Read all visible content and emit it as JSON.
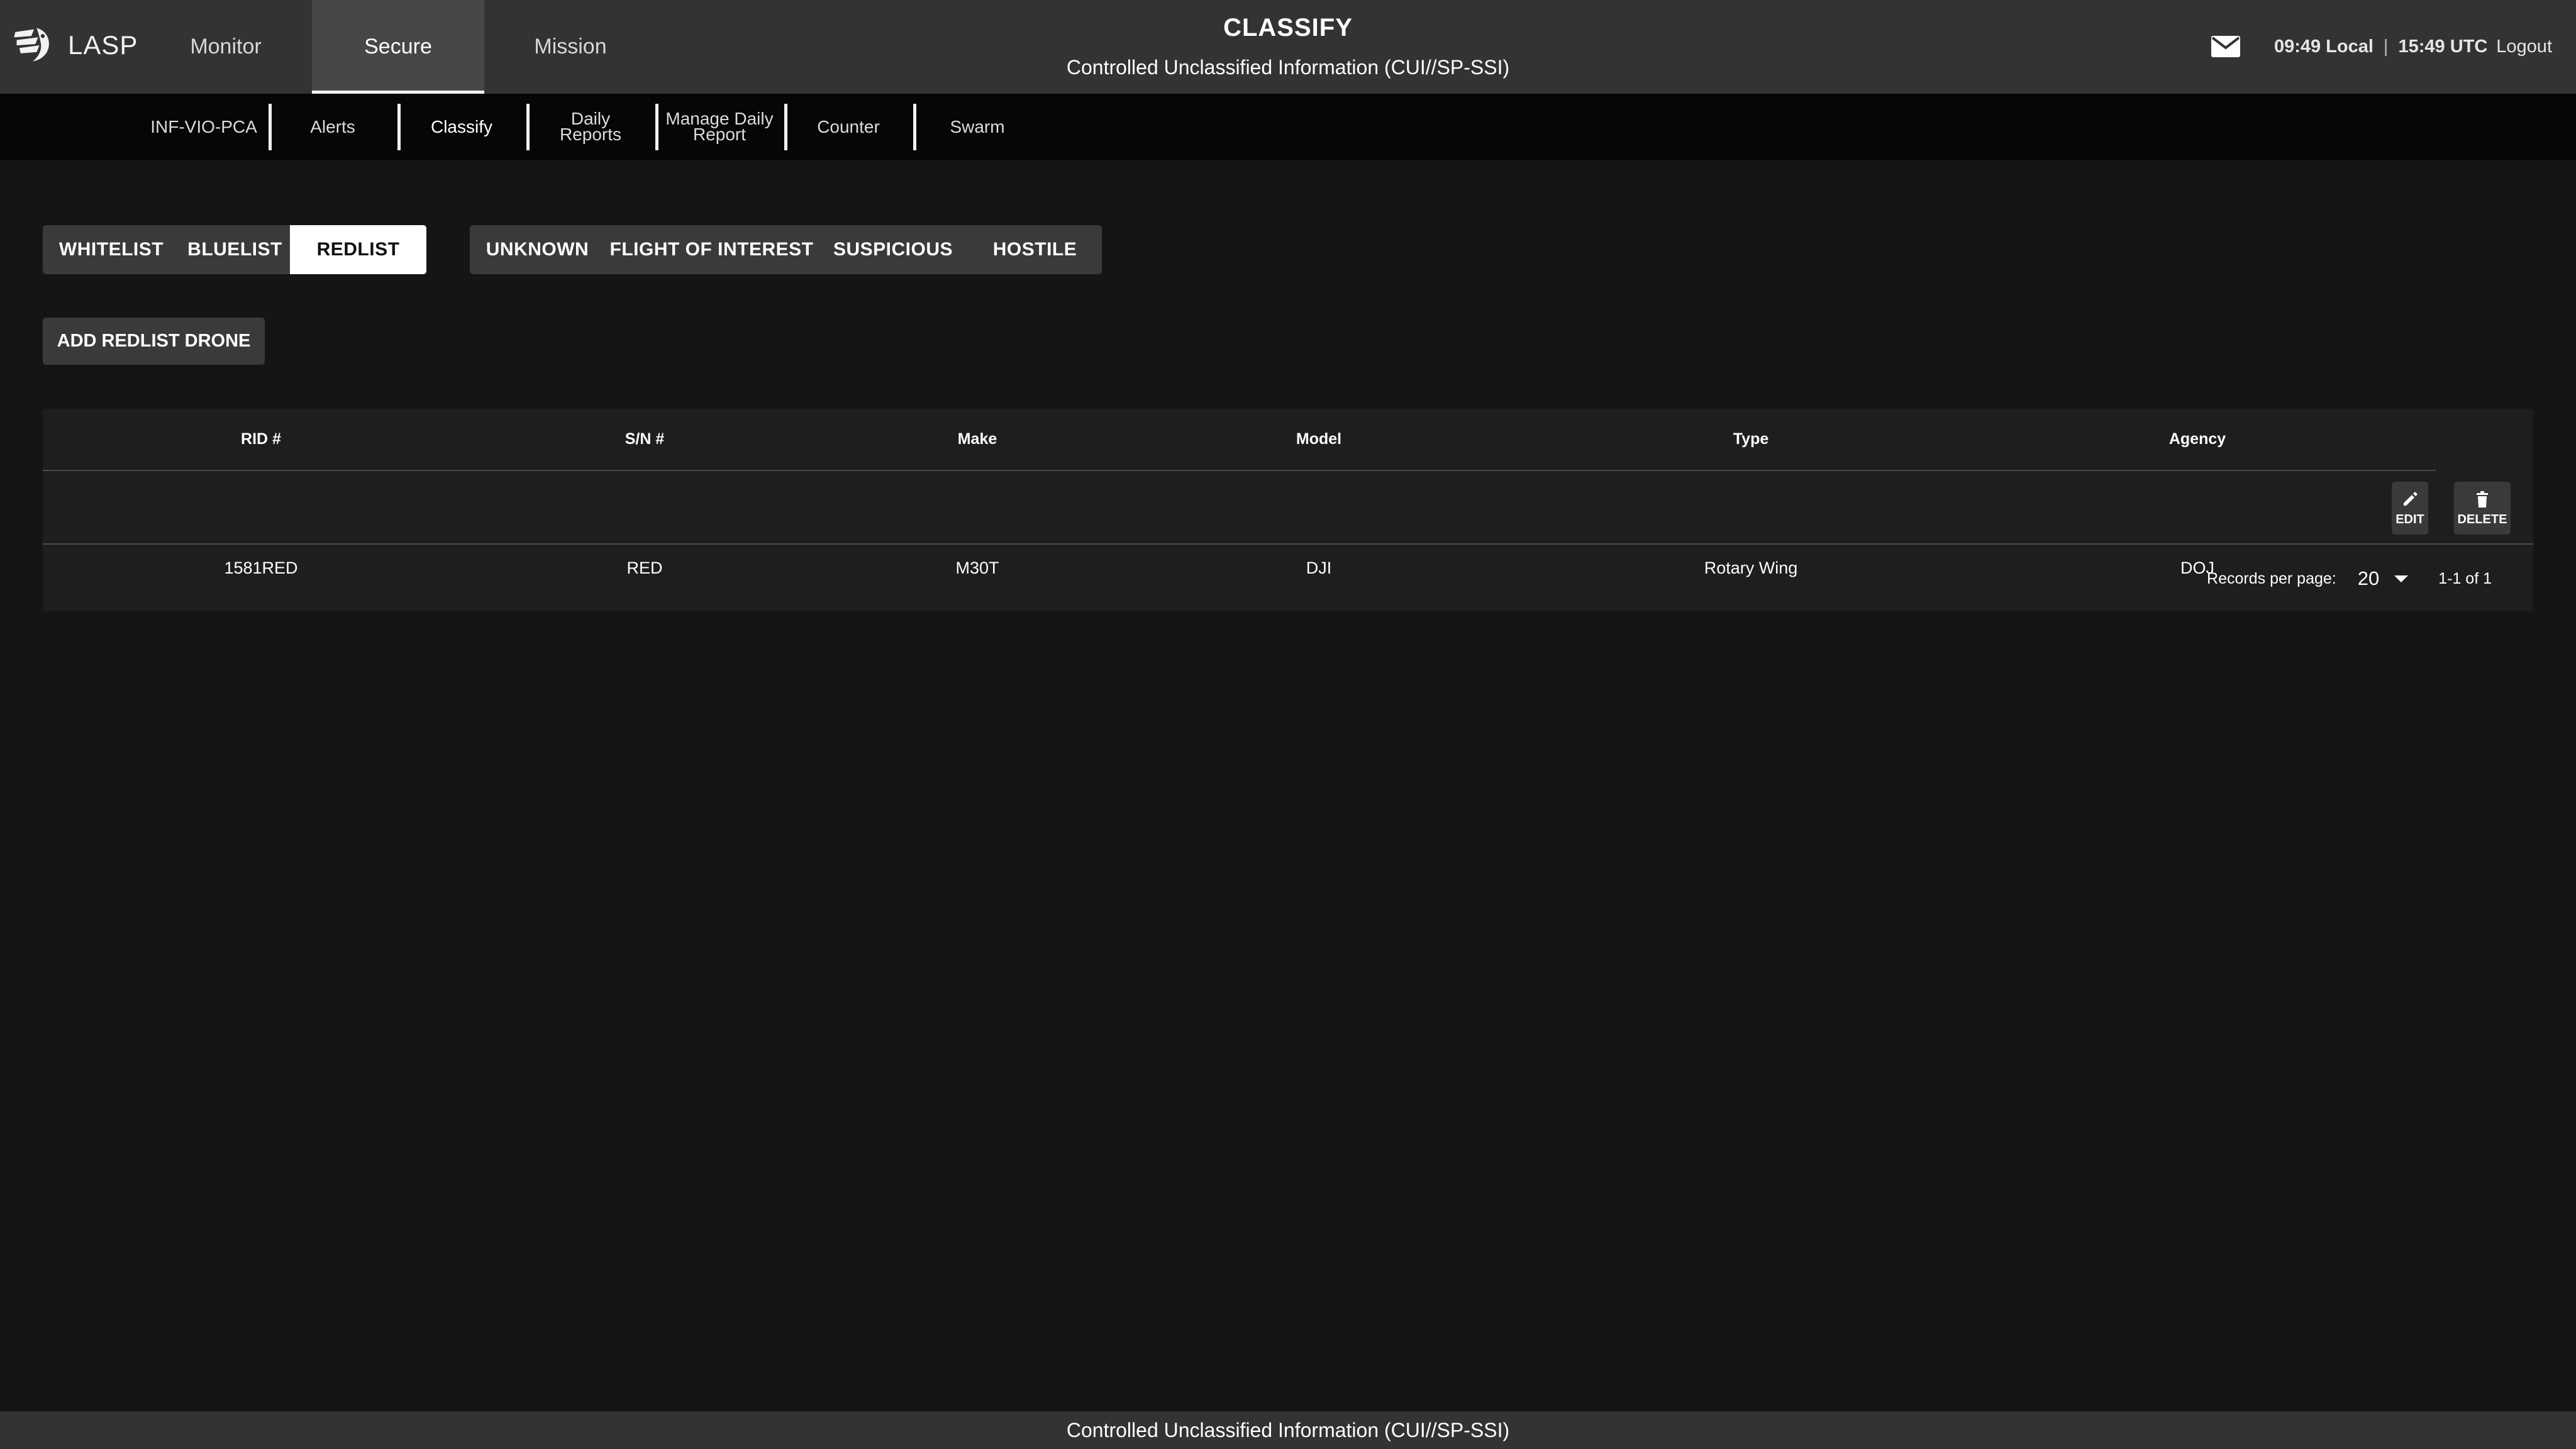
{
  "brand": {
    "name": "LASP"
  },
  "main_tabs": [
    {
      "label": "Monitor"
    },
    {
      "label": "Secure"
    },
    {
      "label": "Mission"
    }
  ],
  "header": {
    "title": "CLASSIFY",
    "subtitle": "Controlled Unclassified Information (CUI//SP-SSI)",
    "local_time": "09:49 Local",
    "separator": "|",
    "utc_time": "15:49 UTC",
    "logout_label": "Logout",
    "mail_icon": "mail-icon"
  },
  "sub_tabs": [
    {
      "line1": "INF-VIO-PCA",
      "line2": ""
    },
    {
      "line1": "Alerts",
      "line2": ""
    },
    {
      "line1": "Classify",
      "line2": ""
    },
    {
      "line1": "Daily",
      "line2": "Reports"
    },
    {
      "line1": "Manage Daily",
      "line2": "Report"
    },
    {
      "line1": "Counter",
      "line2": ""
    },
    {
      "line1": "Swarm",
      "line2": ""
    }
  ],
  "list_toggle": [
    "WHITELIST",
    "BLUELIST",
    "REDLIST"
  ],
  "list_toggle_selected": "REDLIST",
  "class_toggle": [
    "UNKNOWN",
    "FLIGHT OF INTEREST",
    "SUSPICIOUS",
    "HOSTILE"
  ],
  "add_button": "ADD REDLIST DRONE",
  "table": {
    "columns": [
      "RID #",
      "S/N #",
      "Make",
      "Model",
      "Type",
      "Agency"
    ],
    "rows": [
      [
        "1581RED",
        "RED",
        "M30T",
        "DJI",
        "Rotary Wing",
        "DOJ"
      ]
    ],
    "edit_label": "EDIT",
    "delete_label": "DELETE"
  },
  "pagination": {
    "records_label": "Records per page:",
    "per_page": "20",
    "range": "1-1 of 1"
  },
  "footer": {
    "text": "Controlled Unclassified Information (CUI//SP-SSI)"
  },
  "colors": {
    "background": "#151515",
    "topbar": "#333333",
    "subnav": "#060606",
    "button": "#3a3a3a",
    "active_button": "#ffffff"
  }
}
